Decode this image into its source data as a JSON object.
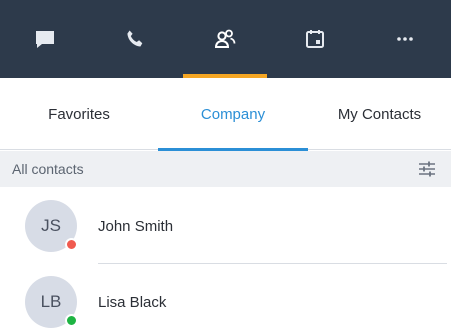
{
  "nav": {
    "items": [
      {
        "icon": "chat-icon"
      },
      {
        "icon": "phone-icon"
      },
      {
        "icon": "contacts-icon",
        "active": true
      },
      {
        "icon": "calendar-icon"
      },
      {
        "icon": "more-icon"
      }
    ],
    "accent": "#f5a623",
    "background": "#2d3a4b"
  },
  "tabs": [
    {
      "label": "Favorites",
      "active": false
    },
    {
      "label": "Company",
      "active": true
    },
    {
      "label": "My Contacts",
      "active": false
    }
  ],
  "section": {
    "title": "All contacts",
    "icon": "filter-sliders-icon"
  },
  "contacts": [
    {
      "initials": "JS",
      "name": "John Smith",
      "status_color": "#f05a4f"
    },
    {
      "initials": "LB",
      "name": "Lisa Black",
      "status_color": "#1eb443"
    }
  ],
  "colors": {
    "tab_active": "#2b8fd6"
  }
}
